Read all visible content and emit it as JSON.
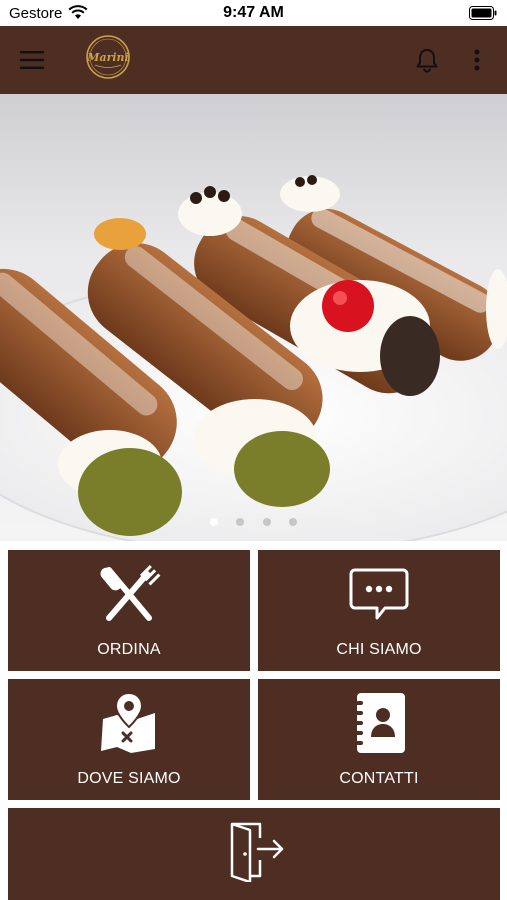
{
  "status_bar": {
    "carrier": "Gestore",
    "time": "9:47 AM"
  },
  "header": {
    "logo_text": "Marini"
  },
  "carousel": {
    "slide_count": 4,
    "active_index": 0
  },
  "menu": {
    "tiles": [
      {
        "label": "ORDINA",
        "icon": "cutlery-icon"
      },
      {
        "label": "CHI SIAMO",
        "icon": "chat-bubble-icon"
      },
      {
        "label": "DOVE SIAMO",
        "icon": "map-pin-icon"
      },
      {
        "label": "CONTATTI",
        "icon": "address-book-icon"
      }
    ],
    "logout_icon": "logout-door-icon"
  },
  "colors": {
    "brand_brown": "#4e2e22",
    "white": "#ffffff"
  }
}
